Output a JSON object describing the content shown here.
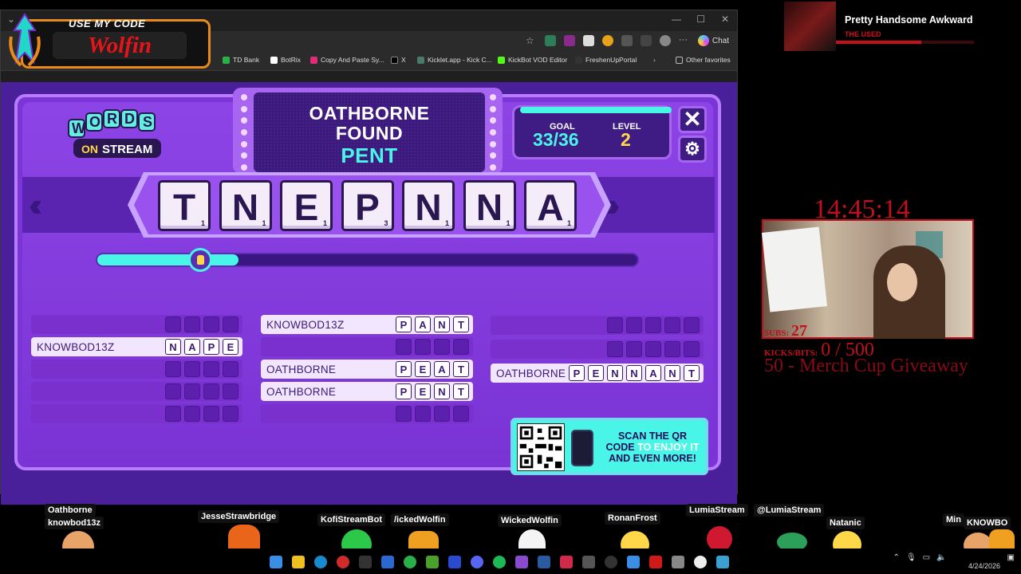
{
  "overlay_promo": {
    "top_text": "USE MY CODE",
    "code": "Wolfin"
  },
  "browser": {
    "chat_label": "Chat",
    "bookmarks": [
      "TD Bank",
      "BotRix",
      "Copy And Paste Sy...",
      "X",
      "Kicklet.app - Kick C...",
      "KickBot VOD Editor",
      "FreshenUpPortal"
    ],
    "other_favorites": "Other favorites"
  },
  "game": {
    "logo_top": "WORDS",
    "logo_bottom": "ON STREAM",
    "found_user": "OATHBORNE",
    "found_label": "FOUND",
    "found_word": "PENT",
    "goal_label": "GOAL",
    "goal_value": "33/36",
    "level_label": "LEVEL",
    "level_value": "2",
    "close_symbol": "✕",
    "gear_symbol": "⚙",
    "tiles": [
      {
        "letter": "T",
        "score": "1"
      },
      {
        "letter": "N",
        "score": "1"
      },
      {
        "letter": "E",
        "score": "1"
      },
      {
        "letter": "P",
        "score": "3"
      },
      {
        "letter": "N",
        "score": "1"
      },
      {
        "letter": "N",
        "score": "1"
      },
      {
        "letter": "A",
        "score": "1"
      }
    ],
    "progress": 0.19,
    "columns": [
      [
        {
          "name": "",
          "letters": [
            "",
            "",
            "",
            ""
          ]
        },
        {
          "name": "KNOWBOD13Z",
          "letters": [
            "N",
            "A",
            "P",
            "E"
          ]
        },
        {
          "name": "",
          "letters": [
            "",
            "",
            "",
            ""
          ]
        },
        {
          "name": "",
          "letters": [
            "",
            "",
            "",
            ""
          ]
        },
        {
          "name": "",
          "letters": [
            "",
            "",
            "",
            ""
          ]
        }
      ],
      [
        {
          "name": "KNOWBOD13Z",
          "letters": [
            "P",
            "A",
            "N",
            "T"
          ]
        },
        {
          "name": "",
          "letters": [
            "",
            "",
            "",
            ""
          ]
        },
        {
          "name": "OATHBORNE",
          "letters": [
            "P",
            "E",
            "A",
            "T"
          ]
        },
        {
          "name": "OATHBORNE",
          "letters": [
            "P",
            "E",
            "N",
            "T"
          ]
        },
        {
          "name": "",
          "letters": [
            "",
            "",
            "",
            ""
          ]
        }
      ],
      [
        {
          "name": "",
          "letters": [
            "",
            "",
            "",
            "",
            ""
          ]
        },
        {
          "name": "",
          "letters": [
            "",
            "",
            "",
            "",
            ""
          ]
        },
        {
          "name": "OATHBORNE",
          "letters": [
            "P",
            "E",
            "N",
            "N",
            "A",
            "N",
            "T"
          ]
        }
      ]
    ],
    "qr_line1": "SCAN THE QR",
    "qr_line2a": "CODE",
    "qr_line2b": "TO ENJOY IT",
    "qr_line3": "AND EVEN MORE!"
  },
  "now_playing": {
    "title": "Pretty Handsome Awkward",
    "artist": "THE USED"
  },
  "stream": {
    "clock": "14:45:14",
    "subs_label": "SUBS:",
    "subs_value": "27",
    "kicks_label": "KICKS/BITS:",
    "kicks_value": "0 / 500",
    "goal_text": "50 - Merch Cup Giveaway"
  },
  "chatters": {
    "oathborne": "Oathborne",
    "knowbod": "knowbod13z",
    "jesse": "JesseStrawbridge",
    "kofi": "KofiStreamBot",
    "wicked1": "/ickedWolfin",
    "wicked2": "WickedWolfin",
    "ronan": "RonanFrost",
    "lumia": "LumiaStream",
    "lumia_at": "@LumiaStream",
    "natanic": "Natanic",
    "min": "Min",
    "knowbo_cut": "KNOWBO"
  },
  "taskbar": {
    "date": "4/24/2026"
  },
  "colors": {
    "board": "#7b34d6",
    "accent_cyan": "#48f5e6",
    "level_yellow": "#ffd84a",
    "stream_red": "#c0101c"
  }
}
